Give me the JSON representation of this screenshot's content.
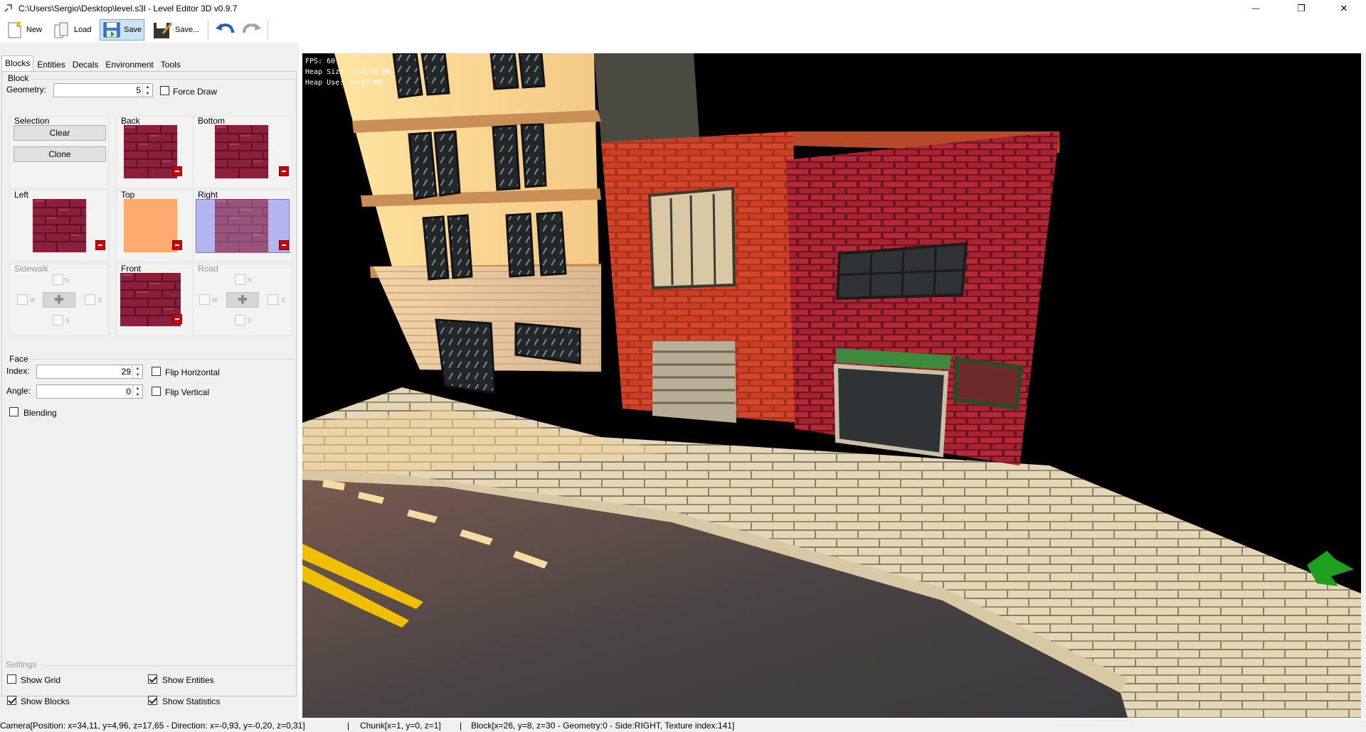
{
  "window": {
    "title": "C:\\Users\\Sergio\\Desktop\\level.s3l - Level Editor 3D v0.9.7",
    "minimize_glyph": "—",
    "maximize_glyph": "❐",
    "close_glyph": "✕"
  },
  "toolbar": {
    "new_label": "New",
    "load_label": "Load",
    "save_label": "Save",
    "saveas_label": "Save...",
    "undo_icon": "undo-icon",
    "redo_icon": "redo-icon"
  },
  "tabs": [
    "Blocks",
    "Entities",
    "Decals",
    "Environment",
    "Tools"
  ],
  "block": {
    "group_label": "Block",
    "geometry_label": "Geometry:",
    "geometry_value": "5",
    "force_draw_label": "Force Draw",
    "force_draw_checked": false,
    "selection_label": "Selection",
    "clear_label": "Clear",
    "clone_label": "Clone",
    "faces": {
      "back": "Back",
      "bottom": "Bottom",
      "left": "Left",
      "top": "Top",
      "right": "Right",
      "sidewalk": "Sidewalk",
      "front": "Front",
      "road": "Road"
    },
    "compass": {
      "n": "N",
      "w": "W",
      "e": "E",
      "s": "S"
    }
  },
  "face": {
    "group_label": "Face",
    "index_label": "Index:",
    "index_value": "29",
    "angle_label": "Angle:",
    "angle_value": "0",
    "flip_h_label": "Flip Horizontal",
    "flip_v_label": "Flip Vertical",
    "blending_label": "Blending"
  },
  "settings": {
    "group_label": "Settings",
    "show_grid_label": "Show Grid",
    "show_grid": false,
    "show_entities_label": "Show Entities",
    "show_entities": true,
    "show_blocks_label": "Show Blocks",
    "show_blocks": true,
    "show_statistics_label": "Show Statistics",
    "show_statistics": true
  },
  "hud": {
    "fps": "FPS: 60",
    "heap_size": "Heap Size: 116,00 MB",
    "heap_use": "Heap Use: 34,23 MB"
  },
  "status": {
    "camera": "Camera[Position: x=34,11, y=4,96, z=17,65 - Direction: x=-0,93, y=-0,20, z=0,31]",
    "sep1": "|",
    "chunk": "Chunk[x=1, y=0, z=1]",
    "sep2": "|",
    "block": "Block[x=26, y=8, z=30 - Geometry:0 - Side:RIGHT, Texture index:141]"
  },
  "colors": {
    "brick": "#8b1f3c",
    "orange": "#ffaa6e",
    "selected": "#b4b4f0",
    "accent": "#3c7ee6"
  }
}
